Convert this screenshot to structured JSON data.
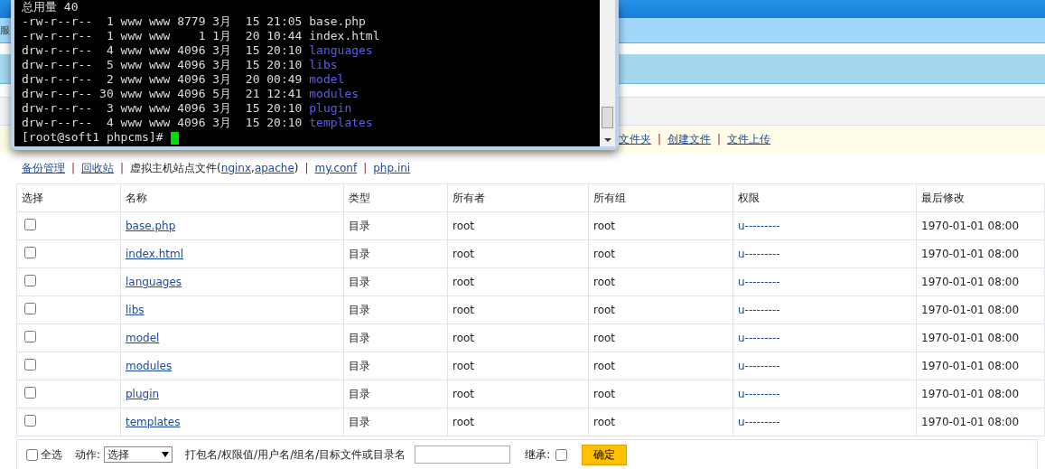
{
  "terminal": {
    "header": "总用量 40",
    "lines": [
      {
        "info": "-rw-r--r--  1 www www 8779 3月  15 21:05",
        "name": "base.php",
        "kind": "file"
      },
      {
        "info": "-rw-r--r--  1 www www    1 1月  20 10:44",
        "name": "index.html",
        "kind": "file"
      },
      {
        "info": "drw-r--r--  4 www www 4096 3月  15 20:10",
        "name": "languages",
        "kind": "dir"
      },
      {
        "info": "drw-r--r--  5 www www 4096 3月  15 20:10",
        "name": "libs",
        "kind": "dir"
      },
      {
        "info": "drw-r--r--  2 www www 4096 3月  20 00:49",
        "name": "model",
        "kind": "dir"
      },
      {
        "info": "drw-r--r-- 30 www www 4096 5月  21 12:41",
        "name": "modules",
        "kind": "dir"
      },
      {
        "info": "drw-r--r--  3 www www 4096 3月  15 20:10",
        "name": "plugin",
        "kind": "dir"
      },
      {
        "info": "drw-r--r--  4 www www 4096 3月  15 20:10",
        "name": "templates",
        "kind": "dir"
      }
    ],
    "prompt": "[root@soft1 phpcms]#"
  },
  "side_text": "服",
  "file_actions": [
    {
      "text": "文件夹",
      "kind": "link"
    },
    {
      "text": "|",
      "kind": "sep"
    },
    {
      "text": "创建文件",
      "kind": "link"
    },
    {
      "text": "|",
      "kind": "sep"
    },
    {
      "text": "文件上传",
      "kind": "link"
    }
  ],
  "links": [
    {
      "text": "备份管理",
      "kind": "link"
    },
    {
      "text": "|",
      "kind": "sep"
    },
    {
      "text": "回收站",
      "kind": "link"
    },
    {
      "text": "|",
      "kind": "sep"
    },
    {
      "text": "虚拟主机站点文件(",
      "kind": "text"
    },
    {
      "text": "nginx",
      "kind": "link"
    },
    {
      "text": ",",
      "kind": "text"
    },
    {
      "text": "apache",
      "kind": "link"
    },
    {
      "text": ")",
      "kind": "text"
    },
    {
      "text": "|",
      "kind": "sep"
    },
    {
      "text": "my.conf",
      "kind": "link"
    },
    {
      "text": "|",
      "kind": "sep"
    },
    {
      "text": "php.ini",
      "kind": "link"
    }
  ],
  "table": {
    "columns": [
      "选择",
      "名称",
      "类型",
      "所有者",
      "所有组",
      "权限",
      "最后修改"
    ],
    "rows": [
      {
        "checked": false,
        "name": "base.php",
        "type": "目录",
        "owner": "root",
        "group": "root",
        "perms": "u---------",
        "modified": "1970-01-01 08:00"
      },
      {
        "checked": false,
        "name": "index.html",
        "type": "目录",
        "owner": "root",
        "group": "root",
        "perms": "u---------",
        "modified": "1970-01-01 08:00"
      },
      {
        "checked": false,
        "name": "languages",
        "type": "目录",
        "owner": "root",
        "group": "root",
        "perms": "u---------",
        "modified": "1970-01-01 08:00"
      },
      {
        "checked": false,
        "name": "libs",
        "type": "目录",
        "owner": "root",
        "group": "root",
        "perms": "u---------",
        "modified": "1970-01-01 08:00"
      },
      {
        "checked": false,
        "name": "model",
        "type": "目录",
        "owner": "root",
        "group": "root",
        "perms": "u---------",
        "modified": "1970-01-01 08:00"
      },
      {
        "checked": false,
        "name": "modules",
        "type": "目录",
        "owner": "root",
        "group": "root",
        "perms": "u---------",
        "modified": "1970-01-01 08:00"
      },
      {
        "checked": false,
        "name": "plugin",
        "type": "目录",
        "owner": "root",
        "group": "root",
        "perms": "u---------",
        "modified": "1970-01-01 08:00"
      },
      {
        "checked": false,
        "name": "templates",
        "type": "目录",
        "owner": "root",
        "group": "root",
        "perms": "u---------",
        "modified": "1970-01-01 08:00"
      }
    ]
  },
  "footer": {
    "select_all": {
      "label": "全选",
      "checked": false
    },
    "action_label": "动作:",
    "action_value": "选择",
    "target_label": "打包名/权限值/用户名/组名/目标文件或目录名",
    "inherit_label": "继承:",
    "inherit_checked": false,
    "submit": "确定"
  }
}
